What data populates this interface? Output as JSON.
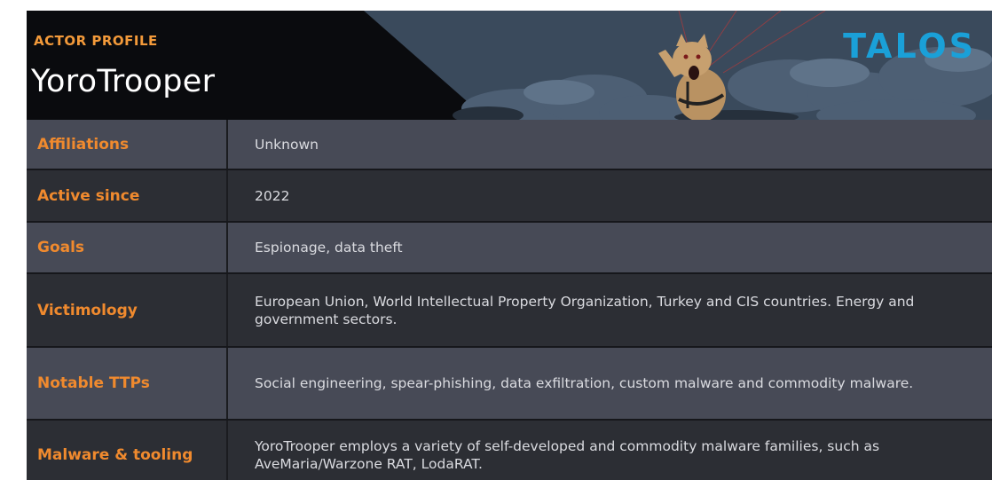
{
  "header": {
    "eyebrow": "ACTOR PROFILE",
    "actor_name": "YoroTrooper",
    "brand": "TALOS"
  },
  "colors": {
    "label": "#f08a2e",
    "eyebrow": "#f39a3a",
    "brand": "#1aa0d8",
    "row_light": "#474a56",
    "row_dark": "#2c2e34",
    "header_bg": "#0a0b0e"
  },
  "rows": [
    {
      "label": "Affiliations",
      "value": "Unknown"
    },
    {
      "label": "Active since",
      "value": "2022"
    },
    {
      "label": "Goals",
      "value": "Espionage, data theft"
    },
    {
      "label": "Victimology",
      "value": "European Union, World Intellectual Property Organization, Turkey and CIS countries. Energy and government sectors."
    },
    {
      "label": "Notable TTPs",
      "value": "Social engineering, spear-phishing, data exfiltration, custom malware and commodity malware."
    },
    {
      "label": "Malware & tooling",
      "value": "YoroTrooper employs a variety of self-developed and commodity malware families, such as AveMaria/Warzone RAT, LodaRAT."
    }
  ],
  "illustration": {
    "icon": "mascot-parachute-illustration"
  }
}
